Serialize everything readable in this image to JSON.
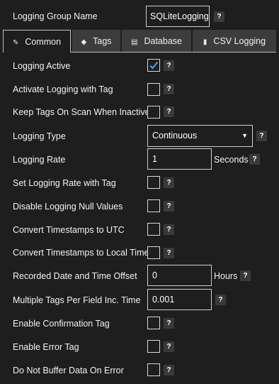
{
  "header": {
    "group_name_label": "Logging Group Name",
    "group_name_value": "SQLiteLogging",
    "help": "?"
  },
  "tabs": [
    {
      "label": "Common",
      "icon": "pencil-icon",
      "active": true
    },
    {
      "label": "Tags",
      "icon": "tag-icon",
      "active": false
    },
    {
      "label": "Database",
      "icon": "database-icon",
      "active": false
    },
    {
      "label": "CSV Logging",
      "icon": "file-icon",
      "active": false
    }
  ],
  "fields": {
    "logging_active": {
      "label": "Logging Active",
      "checked": true
    },
    "activate_with_tag": {
      "label": "Activate Logging with Tag",
      "checked": false
    },
    "keep_tags_on_scan": {
      "label": "Keep Tags On Scan When Inactive",
      "checked": false
    },
    "logging_type": {
      "label": "Logging Type",
      "value": "Continuous"
    },
    "logging_rate": {
      "label": "Logging Rate",
      "value": "1",
      "unit": "Seconds"
    },
    "rate_with_tag": {
      "label": "Set Logging Rate with Tag",
      "checked": false
    },
    "disable_null": {
      "label": "Disable Logging Null Values",
      "checked": false
    },
    "convert_utc": {
      "label": "Convert Timestamps to UTC",
      "checked": false
    },
    "convert_local": {
      "label": "Convert Timestamps to Local Time",
      "checked": false
    },
    "date_offset": {
      "label": "Recorded Date and Time Offset",
      "value": "0",
      "unit": "Hours"
    },
    "multiple_tags": {
      "label": "Multiple Tags Per Field Inc. Time",
      "value": "0.001"
    },
    "confirmation_tag": {
      "label": "Enable Confirmation Tag",
      "checked": false
    },
    "error_tag": {
      "label": "Enable Error Tag",
      "checked": false
    },
    "no_buffer": {
      "label": "Do Not Buffer Data On Error",
      "checked": false
    }
  },
  "help_text": "?",
  "colors": {
    "background": "#1e1e1e",
    "tab_inactive": "#3c3c3c",
    "check_accent": "#4aa3e8",
    "border": "#cfcfcf"
  }
}
